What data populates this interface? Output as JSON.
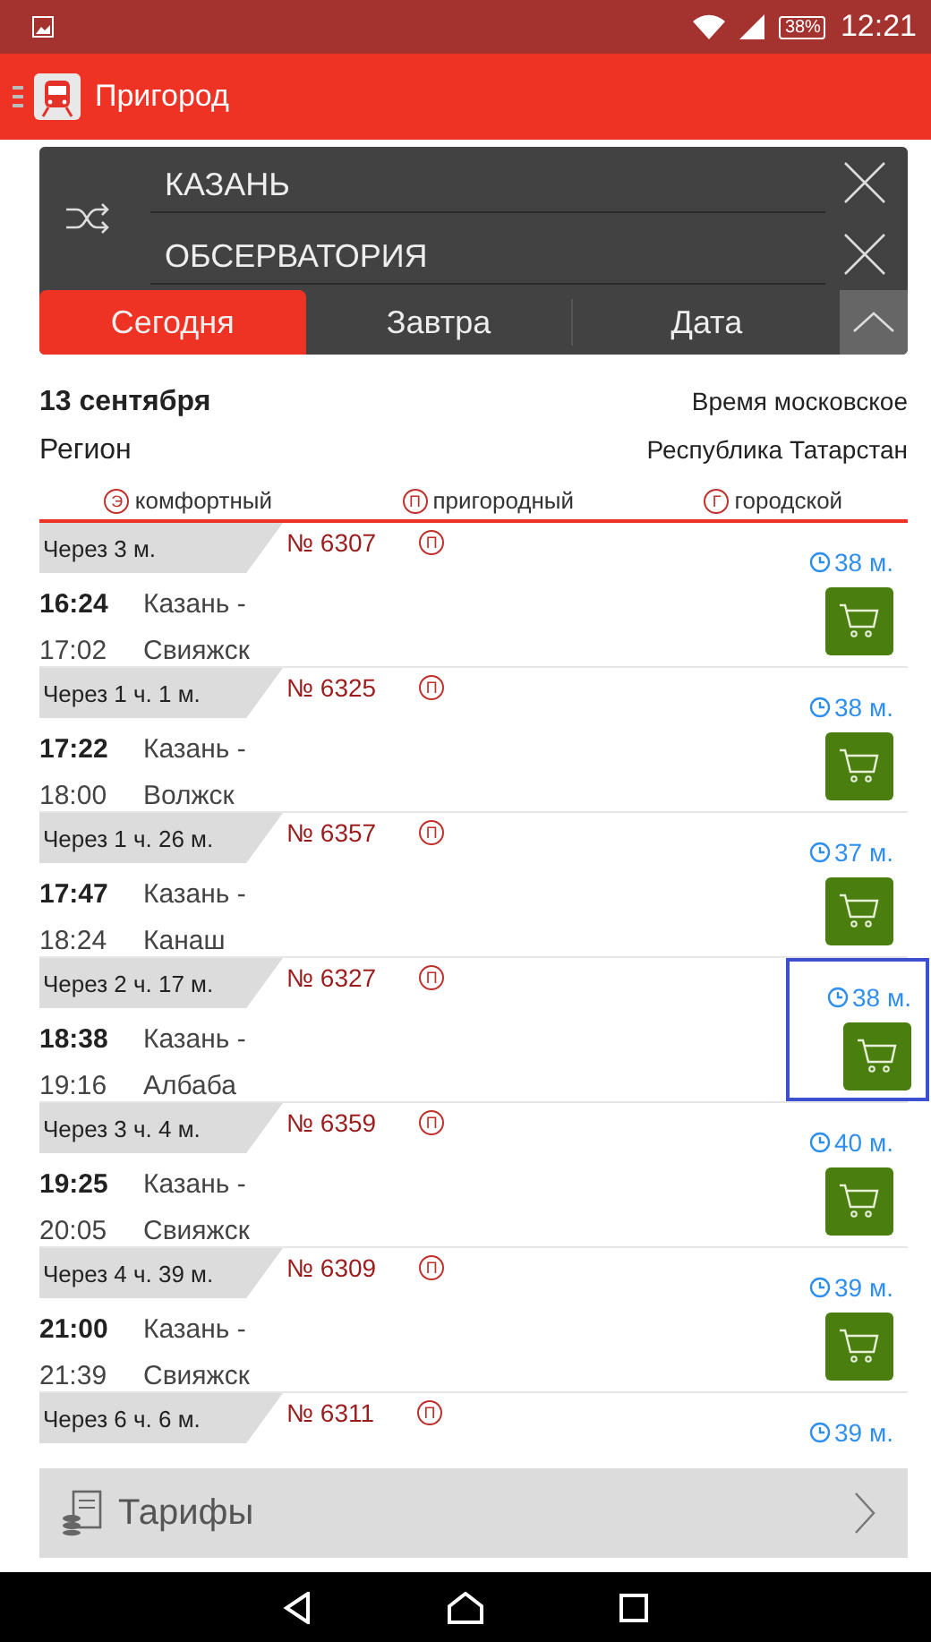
{
  "status_bar": {
    "battery": "38%",
    "time": "12:21"
  },
  "app_bar": {
    "title": "Пригород"
  },
  "route": {
    "from": "КАЗАНЬ",
    "to": "ОБСЕРВАТОРИЯ"
  },
  "tabs": [
    {
      "label": "Сегодня",
      "selected": true
    },
    {
      "label": "Завтра",
      "selected": false
    },
    {
      "label": "Дата",
      "selected": false
    }
  ],
  "info": {
    "date": "13 сентября",
    "time_zone": "Время московское",
    "region_label": "Регион",
    "region": "Республика Татарстан"
  },
  "legend": [
    {
      "mark": "Э",
      "label": "комфортный"
    },
    {
      "mark": "П",
      "label": "пригородный"
    },
    {
      "mark": "Г",
      "label": "городской"
    }
  ],
  "trains": [
    {
      "departs_in": "Через 3 м.",
      "number": "№ 6307",
      "type_mark": "П",
      "departure": "16:24",
      "arrival": "17:02",
      "from": "Казань -",
      "to": "Свияжск",
      "duration": "38 м.",
      "selected": false
    },
    {
      "departs_in": "Через 1 ч. 1 м.",
      "number": "№ 6325",
      "type_mark": "П",
      "departure": "17:22",
      "arrival": "18:00",
      "from": "Казань -",
      "to": "Волжск",
      "duration": "38 м.",
      "selected": false
    },
    {
      "departs_in": "Через 1 ч. 26 м.",
      "number": "№ 6357",
      "type_mark": "П",
      "departure": "17:47",
      "arrival": "18:24",
      "from": "Казань -",
      "to": "Канаш",
      "duration": "37 м.",
      "selected": false
    },
    {
      "departs_in": "Через 2 ч. 17 м.",
      "number": "№ 6327",
      "type_mark": "П",
      "departure": "18:38",
      "arrival": "19:16",
      "from": "Казань -",
      "to": "Албаба",
      "duration": "38 м.",
      "selected": true
    },
    {
      "departs_in": "Через 3 ч. 4 м.",
      "number": "№ 6359",
      "type_mark": "П",
      "departure": "19:25",
      "arrival": "20:05",
      "from": "Казань -",
      "to": "Свияжск",
      "duration": "40 м.",
      "selected": false
    },
    {
      "departs_in": "Через 4 ч. 39 м.",
      "number": "№ 6309",
      "type_mark": "П",
      "departure": "21:00",
      "arrival": "21:39",
      "from": "Казань -",
      "to": "Свияжск",
      "duration": "39 м.",
      "selected": false
    },
    {
      "departs_in": "Через 6 ч. 6 м.",
      "number": "№ 6311",
      "type_mark": "П",
      "duration": "39 м.",
      "selected": false
    }
  ],
  "footer": {
    "label": "Тарифы"
  }
}
